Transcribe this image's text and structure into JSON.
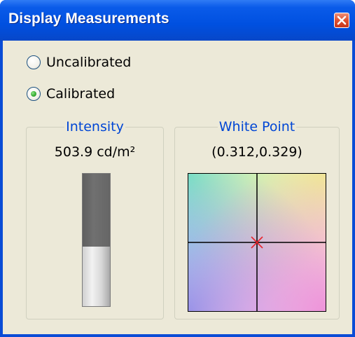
{
  "window": {
    "title": "Display Measurements"
  },
  "mode": {
    "options": [
      {
        "label": "Uncalibrated",
        "selected": false
      },
      {
        "label": "Calibrated",
        "selected": true
      }
    ]
  },
  "intensity": {
    "label": "Intensity",
    "value_text": "503.9 cd/m²",
    "level": 0.45
  },
  "white_point": {
    "label": "White Point",
    "value_text": "(0.312,0.329)",
    "marker_color": "#e8232a"
  },
  "colors": {
    "title_bar": "#0054e3",
    "client_bg": "#ece9d8",
    "group_label": "#0046d5",
    "radio_checked": "#3fb43a"
  },
  "icons": {
    "close": "close-icon",
    "marker": "x-marker-icon"
  }
}
